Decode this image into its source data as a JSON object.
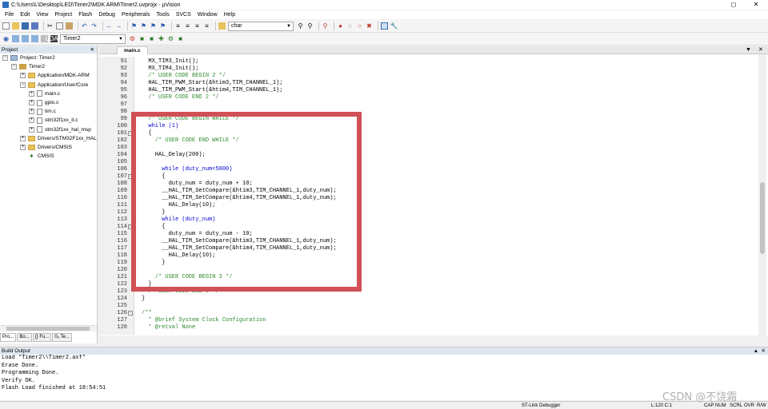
{
  "window": {
    "title": "C:\\Users\\L\\Desktop\\LED\\Timer2\\MDK ARM\\Timer2.uvprojx - µVision"
  },
  "menu": [
    "File",
    "Edit",
    "View",
    "Project",
    "Flash",
    "Debug",
    "Peripherals",
    "Tools",
    "SVCS",
    "Window",
    "Help"
  ],
  "toolbar": {
    "find_combo": "char",
    "target_combo": "Timer2"
  },
  "project": {
    "header": "Project",
    "tree": [
      {
        "label": "Project: Timer2",
        "level": 0,
        "kind": "root",
        "exp": "−"
      },
      {
        "label": "Timer2",
        "level": 1,
        "kind": "target",
        "exp": "−"
      },
      {
        "label": "Application/MDK-ARM",
        "level": 2,
        "kind": "folder",
        "exp": "+"
      },
      {
        "label": "Application/User/Core",
        "level": 2,
        "kind": "folder",
        "exp": "−"
      },
      {
        "label": "main.c",
        "level": 3,
        "kind": "file",
        "exp": "+"
      },
      {
        "label": "gpio.c",
        "level": 3,
        "kind": "file",
        "exp": "+"
      },
      {
        "label": "tim.c",
        "level": 3,
        "kind": "file",
        "exp": "+"
      },
      {
        "label": "stm32f1xx_it.c",
        "level": 3,
        "kind": "file",
        "exp": "+"
      },
      {
        "label": "stm32f1xx_hal_msp",
        "level": 3,
        "kind": "file",
        "exp": "+"
      },
      {
        "label": "Drivers/STM32F1xx_HAL",
        "level": 2,
        "kind": "folder",
        "exp": "+"
      },
      {
        "label": "Drivers/CMSIS",
        "level": 2,
        "kind": "folder",
        "exp": "+"
      },
      {
        "label": "CMSIS",
        "level": 2,
        "kind": "gear",
        "exp": ""
      }
    ],
    "tabs": [
      "Pro...",
      "Bo...",
      "{} Fu...",
      "0ₒ Te..."
    ]
  },
  "editor": {
    "tab": "main.c",
    "lines": [
      {
        "n": "91",
        "f": "",
        "t": "  MX_TIM3_Init();",
        "c": ""
      },
      {
        "n": "92",
        "f": "",
        "t": "  MX_TIM4_Init();",
        "c": ""
      },
      {
        "n": "93",
        "f": "",
        "t": "  /* USER CODE BEGIN 2 */",
        "c": "cm"
      },
      {
        "n": "94",
        "f": "",
        "t": "  HAL_TIM_PWM_Start(&htim3,TIM_CHANNEL_1);",
        "c": ""
      },
      {
        "n": "95",
        "f": "",
        "t": "  HAL_TIM_PWM_Start(&htim4,TIM_CHANNEL_1);",
        "c": ""
      },
      {
        "n": "96",
        "f": "",
        "t": "  /* USER CODE END 2 */",
        "c": "cm"
      },
      {
        "n": "97",
        "f": "",
        "t": "",
        "c": ""
      },
      {
        "n": "98",
        "f": "",
        "t": "",
        "c": ""
      },
      {
        "n": "99",
        "f": "",
        "t": "  /* USER CODE BEGIN WHILE */",
        "c": "cm"
      },
      {
        "n": "100",
        "f": "",
        "t": "  while (1)",
        "c": "kw"
      },
      {
        "n": "101",
        "f": "−",
        "t": "  {",
        "c": ""
      },
      {
        "n": "102",
        "f": "",
        "t": "    /* USER CODE END WHILE */",
        "c": "cm"
      },
      {
        "n": "103",
        "f": "",
        "t": "",
        "c": ""
      },
      {
        "n": "104",
        "f": "",
        "t": "    HAL_Delay(200);",
        "c": ""
      },
      {
        "n": "105",
        "f": "",
        "t": "",
        "c": ""
      },
      {
        "n": "106",
        "f": "",
        "t": "      while (duty_num<5000)",
        "c": "kw"
      },
      {
        "n": "107",
        "f": "−",
        "t": "      {",
        "c": ""
      },
      {
        "n": "108",
        "f": "",
        "t": "        duty_num = duty_num + 10;",
        "c": ""
      },
      {
        "n": "109",
        "f": "",
        "t": "      __HAL_TIM_SetCompare(&htim3,TIM_CHANNEL_1,duty_num);",
        "c": ""
      },
      {
        "n": "110",
        "f": "",
        "t": "      __HAL_TIM_SetCompare(&htim4,TIM_CHANNEL_1,duty_num);",
        "c": ""
      },
      {
        "n": "111",
        "f": "",
        "t": "        HAL_Delay(10);",
        "c": ""
      },
      {
        "n": "112",
        "f": "",
        "t": "      }",
        "c": ""
      },
      {
        "n": "113",
        "f": "",
        "t": "      while (duty_num)",
        "c": "kw"
      },
      {
        "n": "114",
        "f": "−",
        "t": "      {",
        "c": ""
      },
      {
        "n": "115",
        "f": "",
        "t": "        duty_num = duty_num - 10;",
        "c": ""
      },
      {
        "n": "116",
        "f": "",
        "t": "      __HAL_TIM_SetCompare(&htim3,TIM_CHANNEL_1,duty_num);",
        "c": ""
      },
      {
        "n": "117",
        "f": "",
        "t": "      __HAL_TIM_SetCompare(&htim4,TIM_CHANNEL_1,duty_num);",
        "c": ""
      },
      {
        "n": "118",
        "f": "",
        "t": "        HAL_Delay(10);",
        "c": ""
      },
      {
        "n": "119",
        "f": "",
        "t": "      }",
        "c": ""
      },
      {
        "n": "120",
        "f": "",
        "t": "",
        "c": ""
      },
      {
        "n": "121",
        "f": "",
        "t": "    /* USER CODE BEGIN 3 */",
        "c": "cm"
      },
      {
        "n": "122",
        "f": "",
        "t": "  }",
        "c": ""
      },
      {
        "n": "123",
        "f": "",
        "t": "  /* USER CODE END 3 */",
        "c": "cm"
      },
      {
        "n": "124",
        "f": "",
        "t": "}",
        "c": ""
      },
      {
        "n": "125",
        "f": "",
        "t": "",
        "c": ""
      },
      {
        "n": "126",
        "f": "−",
        "t": "/**",
        "c": "cm"
      },
      {
        "n": "127",
        "f": "",
        "t": "  * @brief System Clock Configuration",
        "c": "cm"
      },
      {
        "n": "128",
        "f": "",
        "t": "  * @retval None",
        "c": "cm"
      }
    ]
  },
  "build": {
    "header": "Build Output",
    "lines": [
      "Load \"Timer2\\\\Timer2.axf\"",
      "Erase Done.",
      "Programming Done.",
      "Verify OK.",
      "Flash Load finished at 18:54:51"
    ]
  },
  "status": {
    "debugger": "ST-Link Debugger",
    "position": "L:120 C:1",
    "cap": "CAP",
    "num": "NUM",
    "scrl": "SCRL",
    "ovr": "OVR",
    "rw": "R/W"
  },
  "watermark": "CSDN @不饶霜",
  "colors": {
    "highlight_box": "#d05056",
    "comment": "#2e8b2e",
    "keyword": "#0000cc"
  }
}
